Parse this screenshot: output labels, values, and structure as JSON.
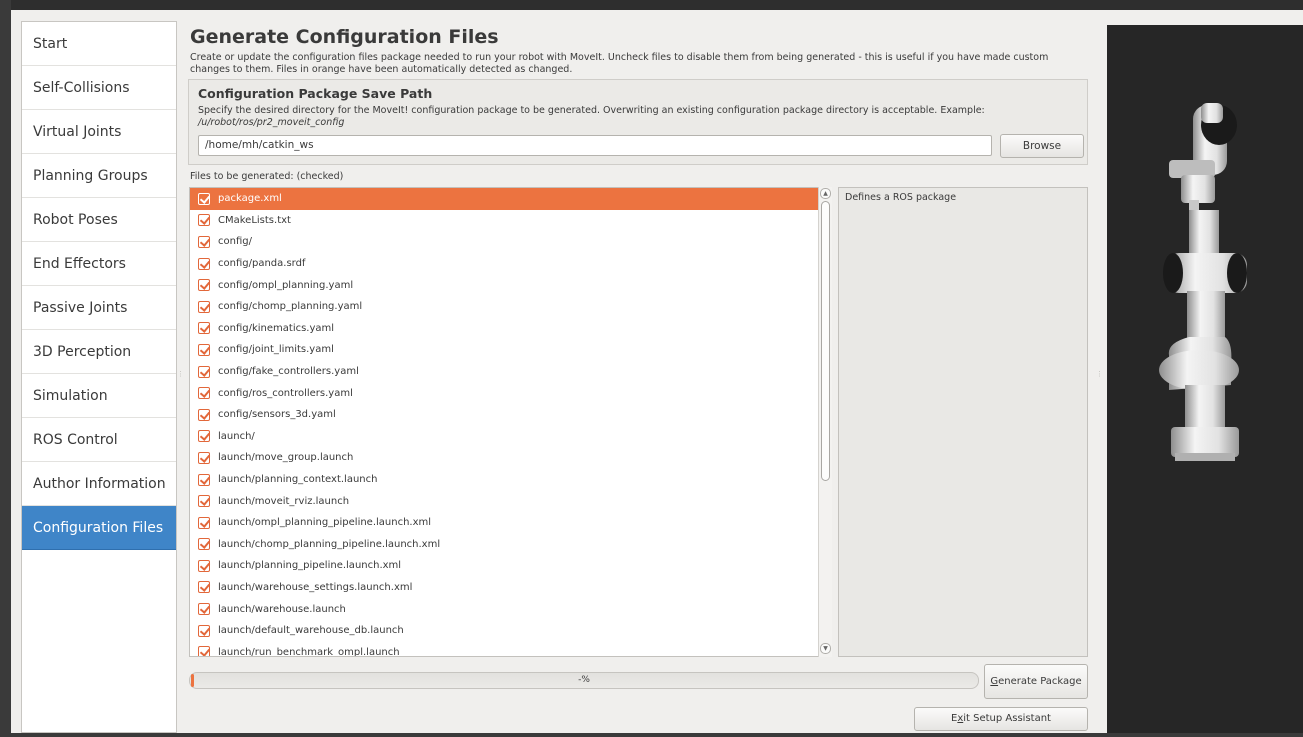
{
  "sidebar": {
    "items": [
      {
        "label": "Start"
      },
      {
        "label": "Self-Collisions"
      },
      {
        "label": "Virtual Joints"
      },
      {
        "label": "Planning Groups"
      },
      {
        "label": "Robot Poses"
      },
      {
        "label": "End Effectors"
      },
      {
        "label": "Passive Joints"
      },
      {
        "label": "3D Perception"
      },
      {
        "label": "Simulation"
      },
      {
        "label": "ROS Control"
      },
      {
        "label": "Author Information"
      },
      {
        "label": "Configuration Files"
      }
    ],
    "active": "Configuration Files"
  },
  "main": {
    "title": "Generate Configuration Files",
    "description": "Create or update the configuration files package needed to run your robot with MoveIt. Uncheck files to disable them from being generated - this is useful if you have made custom changes to them. Files in orange have been automatically detected as changed.",
    "save_path": {
      "title": "Configuration Package Save Path",
      "description_prefix": "Specify the desired directory for the MoveIt! configuration package to be generated. Overwriting an existing configuration package directory is acceptable. Example: ",
      "example_path": "/u/robot/ros/pr2_moveit_config",
      "value": "/home/mh/catkin_ws",
      "browse_label": "Browse"
    },
    "files_label": "Files to be generated: (checked)",
    "files": [
      {
        "name": "package.xml",
        "checked": true,
        "selected": true
      },
      {
        "name": "CMakeLists.txt",
        "checked": true
      },
      {
        "name": "config/",
        "checked": true
      },
      {
        "name": "config/panda.srdf",
        "checked": true
      },
      {
        "name": "config/ompl_planning.yaml",
        "checked": true
      },
      {
        "name": "config/chomp_planning.yaml",
        "checked": true
      },
      {
        "name": "config/kinematics.yaml",
        "checked": true
      },
      {
        "name": "config/joint_limits.yaml",
        "checked": true
      },
      {
        "name": "config/fake_controllers.yaml",
        "checked": true
      },
      {
        "name": "config/ros_controllers.yaml",
        "checked": true
      },
      {
        "name": "config/sensors_3d.yaml",
        "checked": true
      },
      {
        "name": "launch/",
        "checked": true
      },
      {
        "name": "launch/move_group.launch",
        "checked": true
      },
      {
        "name": "launch/planning_context.launch",
        "checked": true
      },
      {
        "name": "launch/moveit_rviz.launch",
        "checked": true
      },
      {
        "name": "launch/ompl_planning_pipeline.launch.xml",
        "checked": true
      },
      {
        "name": "launch/chomp_planning_pipeline.launch.xml",
        "checked": true
      },
      {
        "name": "launch/planning_pipeline.launch.xml",
        "checked": true
      },
      {
        "name": "launch/warehouse_settings.launch.xml",
        "checked": true
      },
      {
        "name": "launch/warehouse.launch",
        "checked": true
      },
      {
        "name": "launch/default_warehouse_db.launch",
        "checked": true
      },
      {
        "name": "launch/run_benchmark_ompl.launch",
        "checked": true
      }
    ],
    "file_description": "Defines a ROS package",
    "progress_text": "-%",
    "generate_label_prefix": "G",
    "generate_label_rest": "enerate Package",
    "exit_label_prefix": "E",
    "exit_label_mid": "x",
    "exit_label_rest": "it Setup Assistant"
  },
  "colors": {
    "accent_orange": "#ec7340",
    "sidebar_active": "#3f85c8",
    "viewport_bg": "#262626"
  }
}
